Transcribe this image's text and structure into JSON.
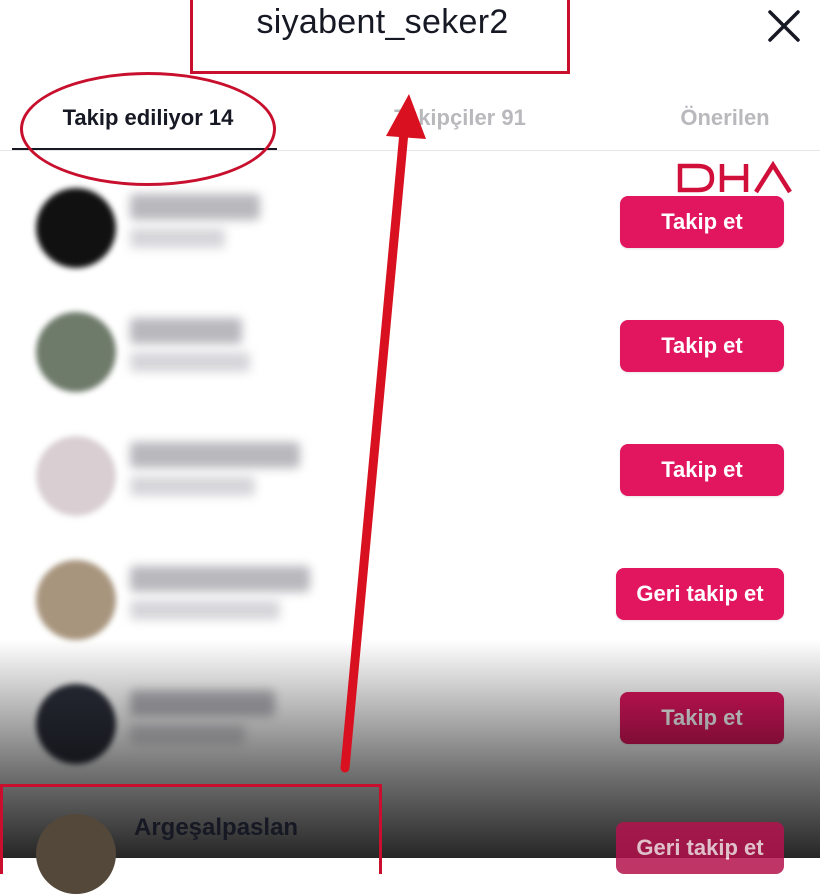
{
  "header": {
    "title": "siyabent_seker2",
    "close_icon": "close-icon"
  },
  "tabs": [
    {
      "label": "Takip ediliyor 14"
    },
    {
      "label": "Takipçiler 91"
    },
    {
      "label": "Önerilen"
    }
  ],
  "watermark": "DHA",
  "users": [
    {
      "button": "Takip et",
      "avatar_color": "#111111"
    },
    {
      "button": "Takip et",
      "avatar_color": "#6e7a6a"
    },
    {
      "button": "Takip et",
      "avatar_color": "#d9cfd2"
    },
    {
      "button": "Geri takip et",
      "avatar_color": "#a8957e"
    },
    {
      "button": "Takip et",
      "avatar_color": "#2b2f3a"
    }
  ],
  "last_user": {
    "name": "Argeşalpaslan",
    "button": "Geri takip et"
  },
  "colors": {
    "accent": "#e2165f",
    "annotation": "#c8102e",
    "text": "#161823"
  }
}
